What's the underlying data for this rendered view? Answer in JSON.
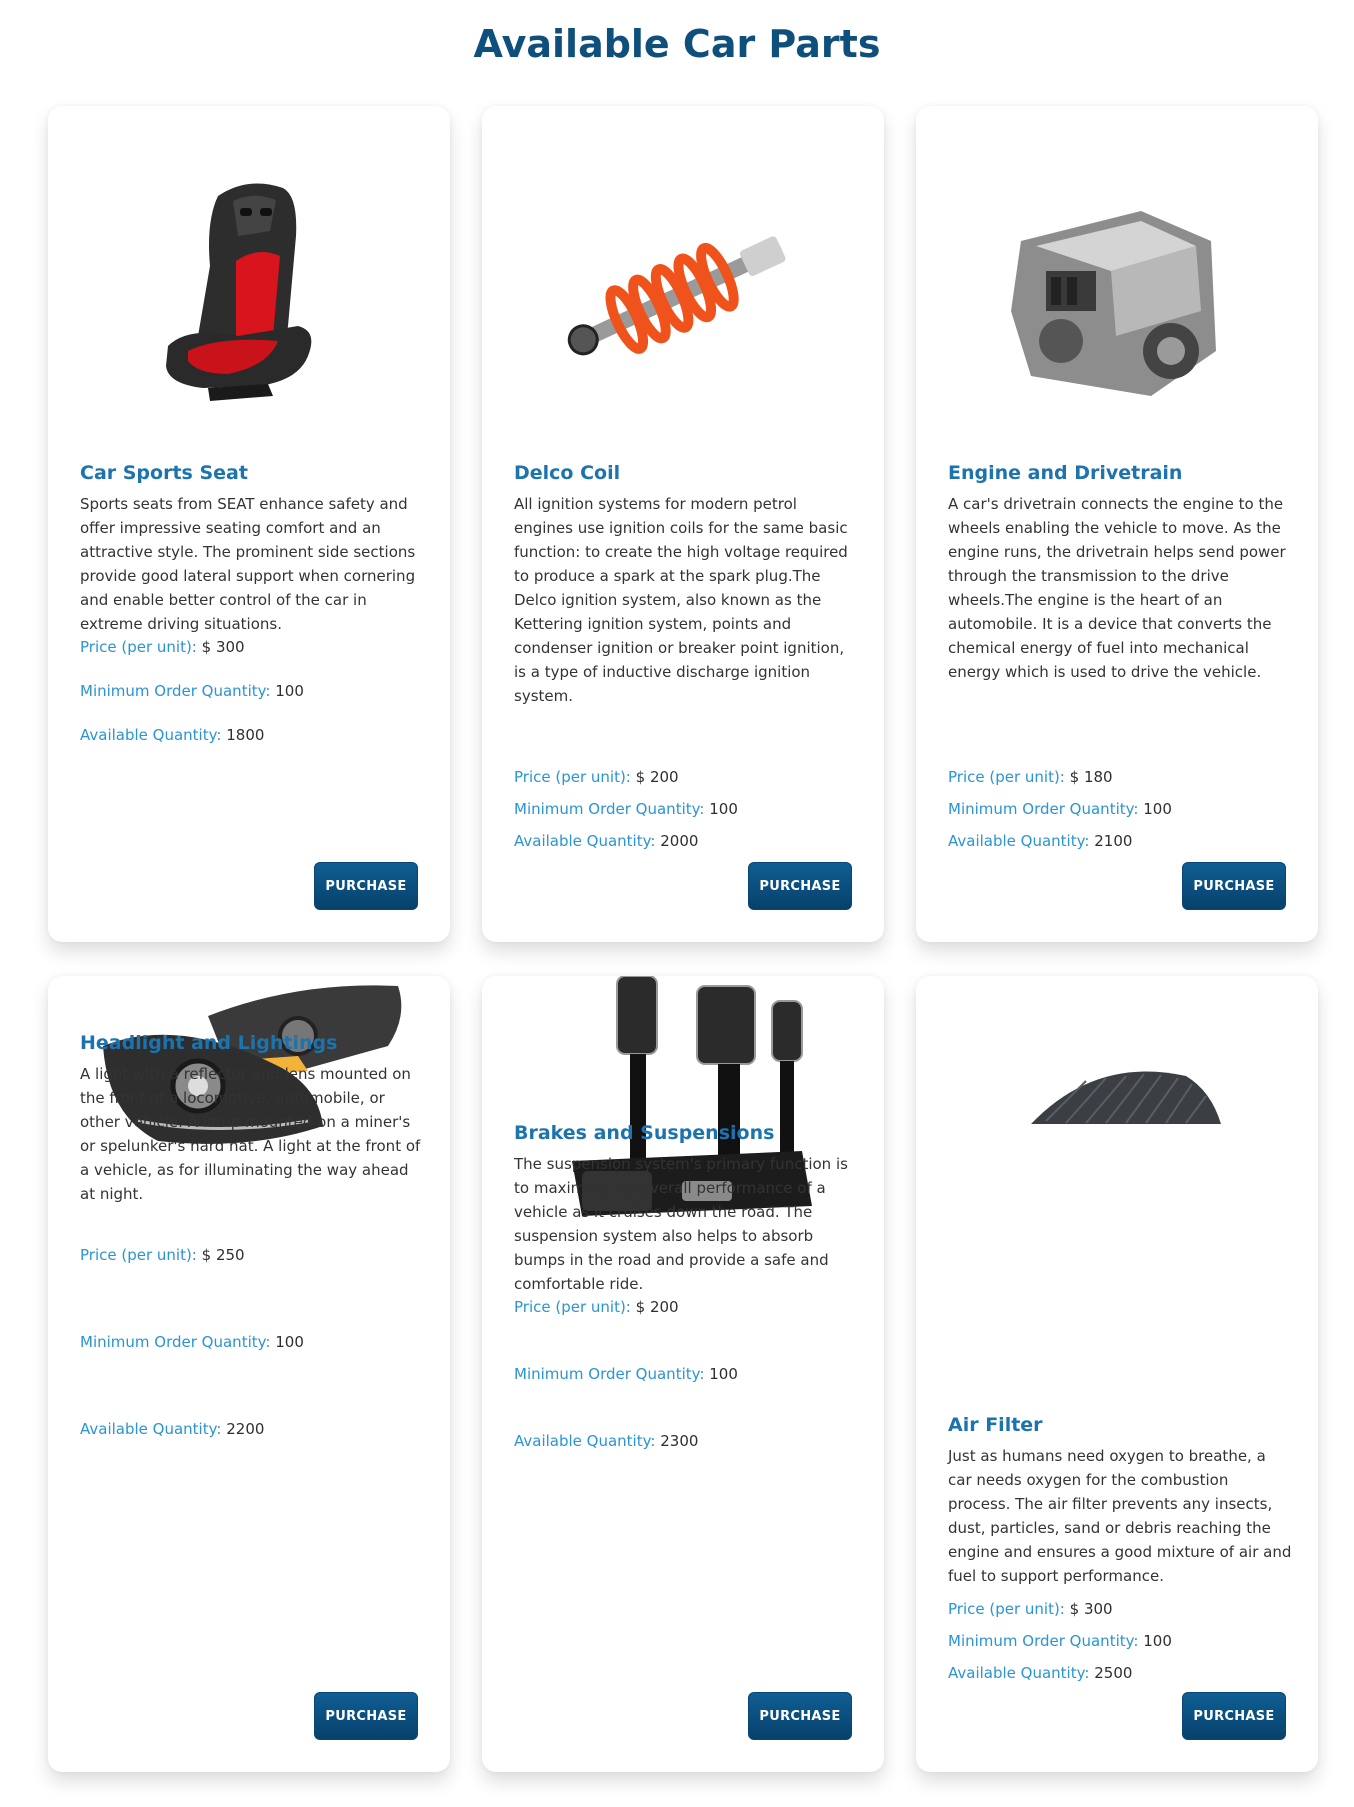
{
  "page": {
    "title": "Available Car Parts"
  },
  "labels": {
    "price": "Price (per unit):",
    "min_order": "Minimum Order Quantity:",
    "available": "Available Quantity:",
    "purchase": "PURCHASE"
  },
  "products": [
    {
      "name": "Car Sports Seat",
      "description": "Sports seats from SEAT enhance safety and offer impressive seating comfort and an attractive style. The prominent side sections provide good lateral support when cornering and enable better control of the car in extreme driving situations.",
      "price": "$ 300",
      "min_order": "100",
      "available": "1800"
    },
    {
      "name": "Delco Coil",
      "description": "All ignition systems for modern petrol engines use ignition coils for the same basic function: to create the high voltage required to produce a spark at the spark plug.The Delco ignition system, also known as the Kettering ignition system, points and condenser ignition or breaker point ignition, is a type of inductive discharge ignition system.",
      "price": "$ 200",
      "min_order": "100",
      "available": "2000"
    },
    {
      "name": "Engine and Drivetrain",
      "description": "A car's drivetrain connects the engine to the wheels enabling the vehicle to move. As the engine runs, the drivetrain helps send power through the transmission to the drive wheels.The engine is the heart of an automobile. It is a device that converts the chemical energy of fuel into mechanical energy which is used to drive the vehicle.",
      "price": "$ 180",
      "min_order": "100",
      "available": "2100"
    },
    {
      "name": "Headlight and Lightings",
      "description": "A light with a reflector and lens mounted on the front of a locomotive, automobile, or other vehicle. A lamp mounted on a miner's or spelunker's hard hat. A light at the front of a vehicle, as for illuminating the way ahead at night.",
      "price": "$ 250",
      "min_order": "100",
      "available": "2200"
    },
    {
      "name": "Brakes and Suspensions",
      "description": "The suspension system's primary function is to maximize the overall performance of a vehicle as it cruises down the road. The suspension system also helps to absorb bumps in the road and provide a safe and comfortable ride.",
      "price": "$ 200",
      "min_order": "100",
      "available": "2300"
    },
    {
      "name": "Air Filter",
      "description": "Just as humans need oxygen to breathe, a car needs oxygen for the combustion process. The air filter prevents any insects, dust, particles, sand or debris reaching the engine and ensures a good mixture of air and fuel to support performance.",
      "price": "$ 300",
      "min_order": "100",
      "available": "2500"
    }
  ]
}
